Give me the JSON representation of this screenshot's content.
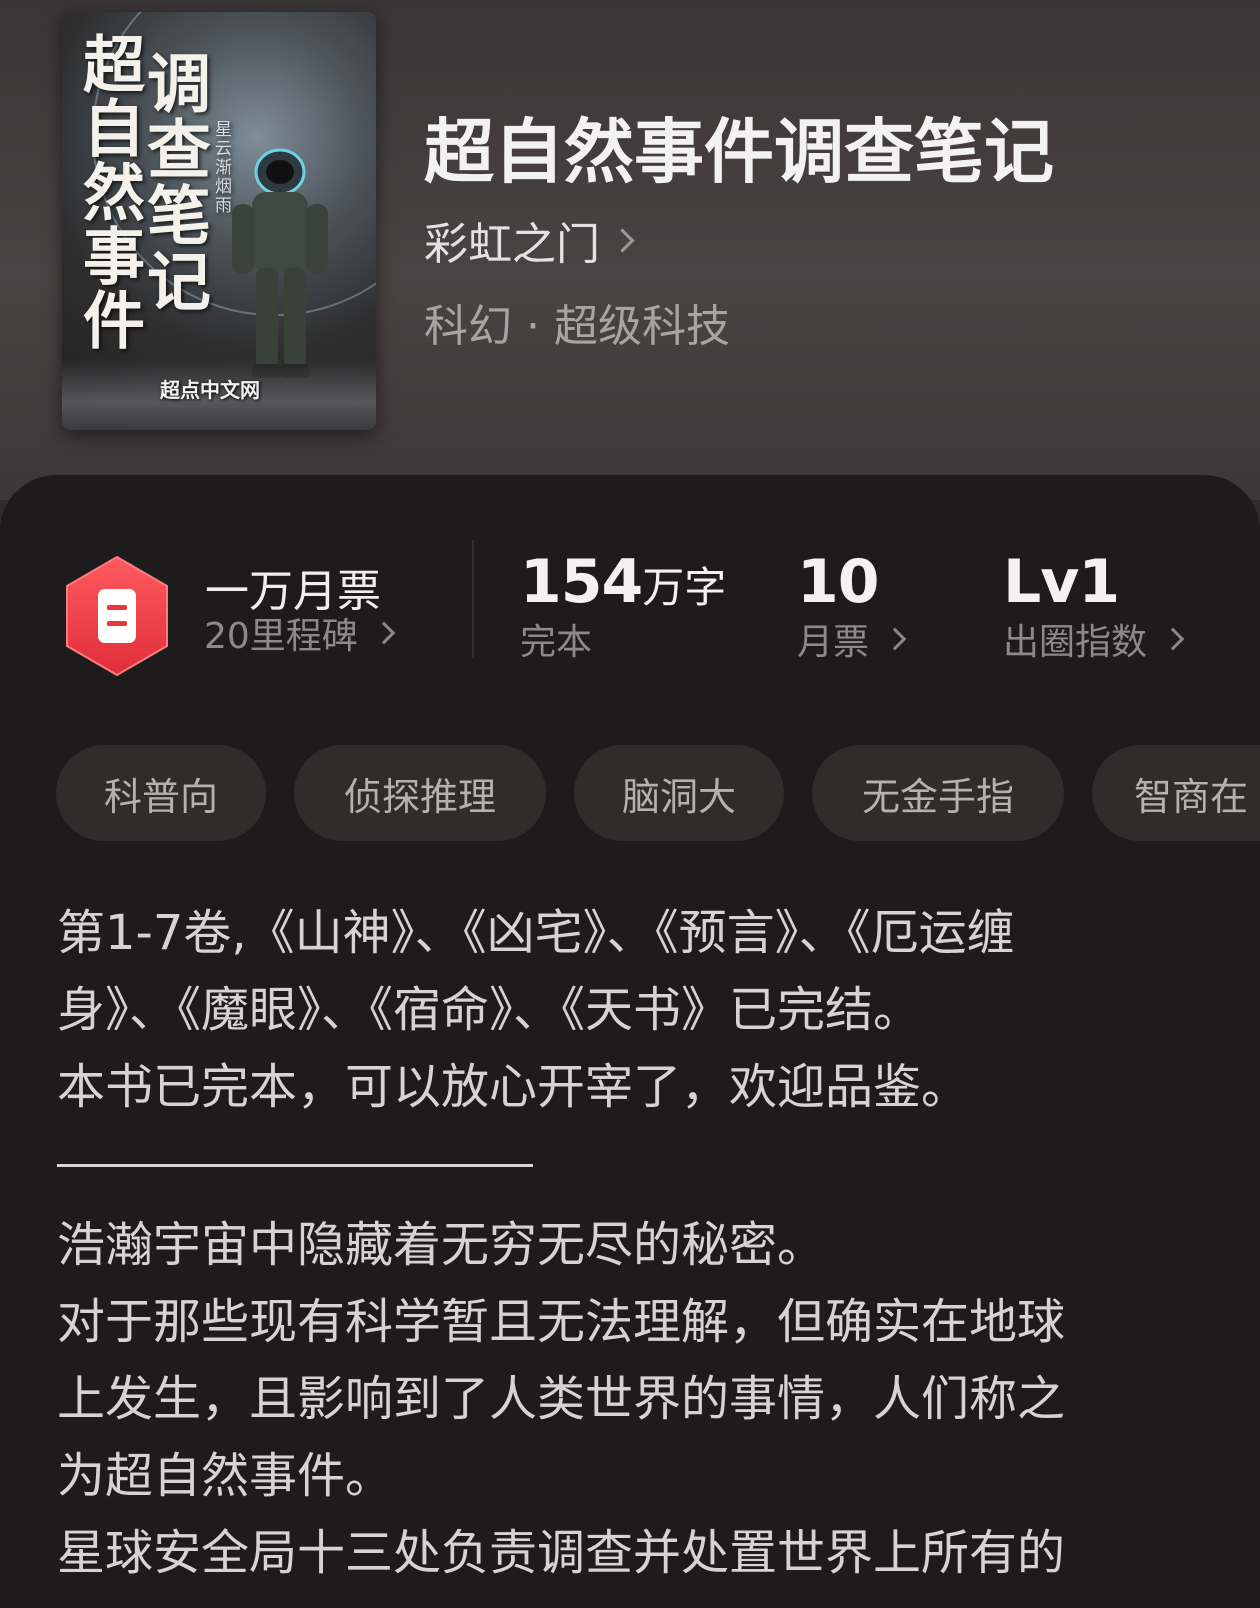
{
  "book": {
    "title": "超自然事件调查笔记",
    "author": "彩虹之门",
    "genre": "科幻 · 超级科技",
    "cover": {
      "title_line1": "超自然事件",
      "title_line2": "调查笔记",
      "small_text": "星云渐烟雨",
      "brand": "超点中文网"
    }
  },
  "stats": {
    "monthly_ticket_label": "一万月票",
    "milestone_label": "20里程碑",
    "word_count_value": "154",
    "word_count_unit": "万字",
    "status": "完本",
    "tickets_value": "10",
    "tickets_label": "月票",
    "level_value": "Lv1",
    "level_label": "出圈指数"
  },
  "tags": [
    "科普向",
    "侦探推理",
    "脑洞大",
    "无金手指",
    "智商在"
  ],
  "description": {
    "lines_before_sep": [
      "第1-7卷,《山神》、《凶宅》、《预言》、《厄运缠",
      "身》、《魔眼》、《宿命》、《天书》已完结。",
      "本书已完本，可以放心开宰了，欢迎品鉴。"
    ],
    "lines_after_sep": [
      "浩瀚宇宙中隐藏着无穷无尽的秘密。",
      "对于那些现有科学暂且无法理解，但确实在地球",
      "上发生，且影响到了人类世界的事情，人们称之",
      "为超自然事件。",
      "星球安全局十三处负责调查并处置世界上所有的"
    ]
  },
  "colors": {
    "badge_red": "#e8363f",
    "panel_bg": "#1d1b1b",
    "header_bg": "#453f40"
  }
}
